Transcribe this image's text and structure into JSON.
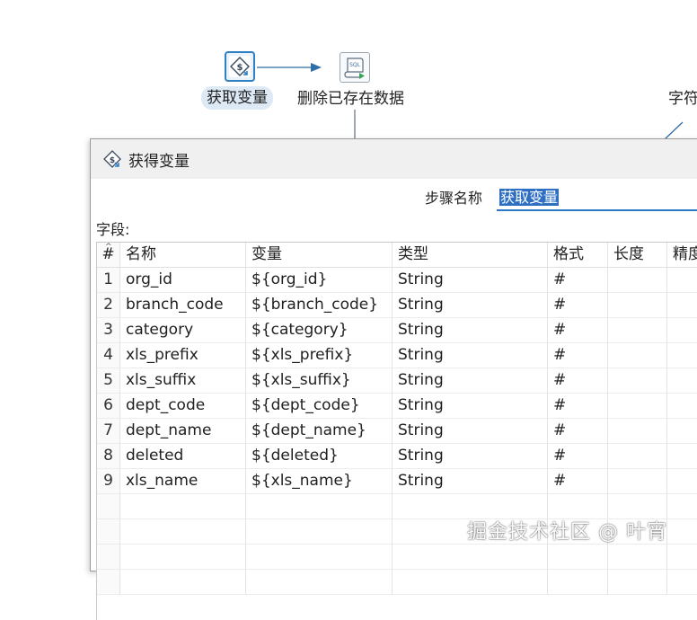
{
  "canvas": {
    "nodes": [
      {
        "label": "获取变量",
        "icon": "get-variables-icon",
        "selected": true
      },
      {
        "label": "删除已存在数据",
        "icon": "sql-script-icon"
      },
      {
        "label": "字符"
      }
    ]
  },
  "dialog": {
    "title": "获得变量",
    "title_icon": "get-variables-icon",
    "step_name_label": "步骤名称",
    "step_name_value": "获取变量",
    "fields_label": "字段:",
    "table": {
      "columns": [
        "#",
        "名称",
        "变量",
        "类型",
        "格式",
        "长度",
        "精度"
      ],
      "rows": [
        [
          "1",
          "org_id",
          "${org_id}",
          "String",
          "#",
          "",
          ""
        ],
        [
          "2",
          "branch_code",
          "${branch_code}",
          "String",
          "#",
          "",
          ""
        ],
        [
          "3",
          "category",
          "${category}",
          "String",
          "#",
          "",
          ""
        ],
        [
          "4",
          "xls_prefix",
          "${xls_prefix}",
          "String",
          "#",
          "",
          ""
        ],
        [
          "5",
          "xls_suffix",
          "${xls_suffix}",
          "String",
          "#",
          "",
          ""
        ],
        [
          "6",
          "dept_code",
          "${dept_code}",
          "String",
          "#",
          "",
          ""
        ],
        [
          "7",
          "dept_name",
          "${dept_name}",
          "String",
          "#",
          "",
          ""
        ],
        [
          "8",
          "deleted",
          "${deleted}",
          "String",
          "#",
          "",
          ""
        ],
        [
          "9",
          "xls_name",
          "${xls_name}",
          "String",
          "#",
          "",
          ""
        ]
      ]
    }
  },
  "watermark": "掘金技术社区 @ 叶宵",
  "colors": {
    "accent": "#2a78c8",
    "selection": "#2e6fc4",
    "node_highlight": "#dde9f5",
    "dialog_chrome": "#f0f0f0"
  }
}
